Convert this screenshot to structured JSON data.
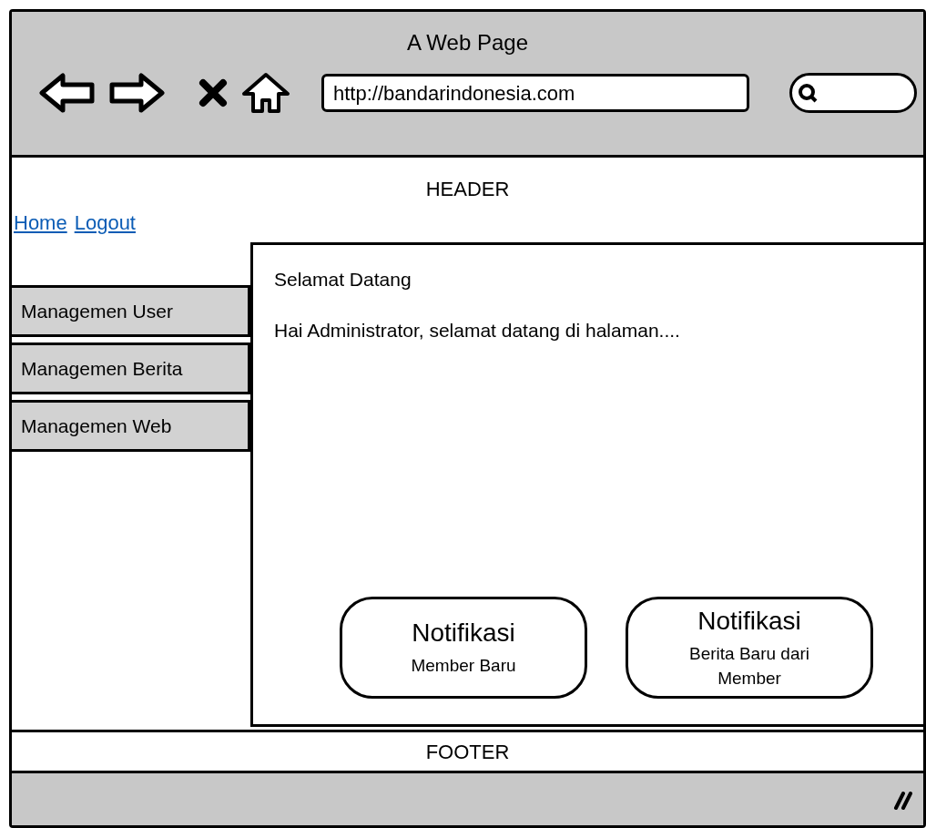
{
  "window": {
    "title": "A Web Page"
  },
  "toolbar": {
    "url": "http://bandarindonesia.com"
  },
  "header": {
    "text": "HEADER",
    "links": [
      "Home",
      "Logout"
    ]
  },
  "sidebar": {
    "items": [
      "Managemen User",
      "Managemen Berita",
      "Managemen Web"
    ]
  },
  "content": {
    "title": "Selamat Datang",
    "message": "Hai Administrator, selamat datang di halaman....",
    "notifications": [
      {
        "title": "Notifikasi",
        "subtitle": "Member Baru"
      },
      {
        "title": "Notifikasi",
        "subtitle": "Berita Baru dari Member"
      }
    ]
  },
  "footer": {
    "text": "FOOTER"
  }
}
